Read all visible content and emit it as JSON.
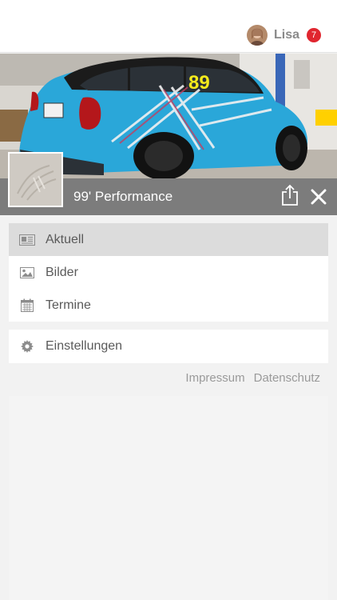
{
  "header": {
    "user_name": "Lisa",
    "notification_count": "7"
  },
  "profile": {
    "title": "99' Performance",
    "car_number": "89"
  },
  "menu": {
    "items": [
      {
        "label": "Aktuell",
        "icon": "news-icon",
        "active": true
      },
      {
        "label": "Bilder",
        "icon": "image-icon",
        "active": false
      },
      {
        "label": "Termine",
        "icon": "calendar-icon",
        "active": false
      }
    ],
    "settings_label": "Einstellungen"
  },
  "footer": {
    "impressum": "Impressum",
    "datenschutz": "Datenschutz"
  },
  "colors": {
    "badge": "#e0262f",
    "car_body": "#2aa7d9",
    "number_yellow": "#f5ea1c",
    "title_bar": "#7c7c7c"
  }
}
